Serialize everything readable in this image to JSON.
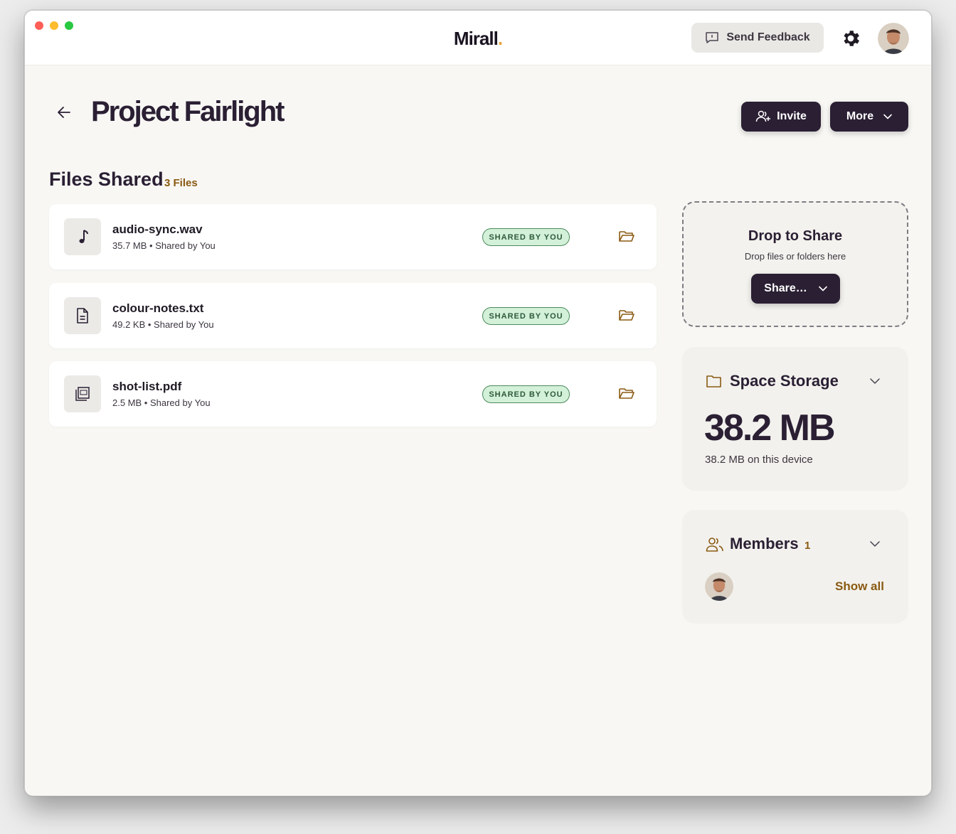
{
  "app": {
    "name": "Mirall",
    "brand_dot": "."
  },
  "header": {
    "feedback_label": "Send Feedback",
    "icons": {
      "feedback": "chat-bubble-icon",
      "settings": "gear-icon"
    }
  },
  "page": {
    "title": "Project Fairlight",
    "invite_label": "Invite",
    "more_label": "More"
  },
  "files_section": {
    "title": "Files Shared",
    "count_label": "3 Files",
    "files": [
      {
        "name": "audio-sync.wav",
        "size": "35.7 MB",
        "shared_by": "Shared by You",
        "badge": "SHARED BY YOU",
        "icon": "music-note-icon"
      },
      {
        "name": "colour-notes.txt",
        "size": "49.2 KB",
        "shared_by": "Shared by You",
        "badge": "SHARED BY YOU",
        "icon": "text-file-icon"
      },
      {
        "name": "shot-list.pdf",
        "size": "2.5 MB",
        "shared_by": "Shared by You",
        "badge": "SHARED BY YOU",
        "icon": "pdf-file-icon"
      }
    ]
  },
  "drop_zone": {
    "title": "Drop to Share",
    "subtitle": "Drop files or folders here",
    "share_label": "Share…"
  },
  "storage": {
    "title": "Space Storage",
    "value": "38.2 MB",
    "subtitle": "38.2 MB on this device"
  },
  "members": {
    "title": "Members",
    "count": "1",
    "show_all_label": "Show all"
  },
  "colors": {
    "primary": "#2a1f33",
    "accent": "#8a5a12",
    "badge_bg": "#d3f0d9",
    "badge_border": "#4c8a5a",
    "brand_dot": "#e8a53a"
  }
}
